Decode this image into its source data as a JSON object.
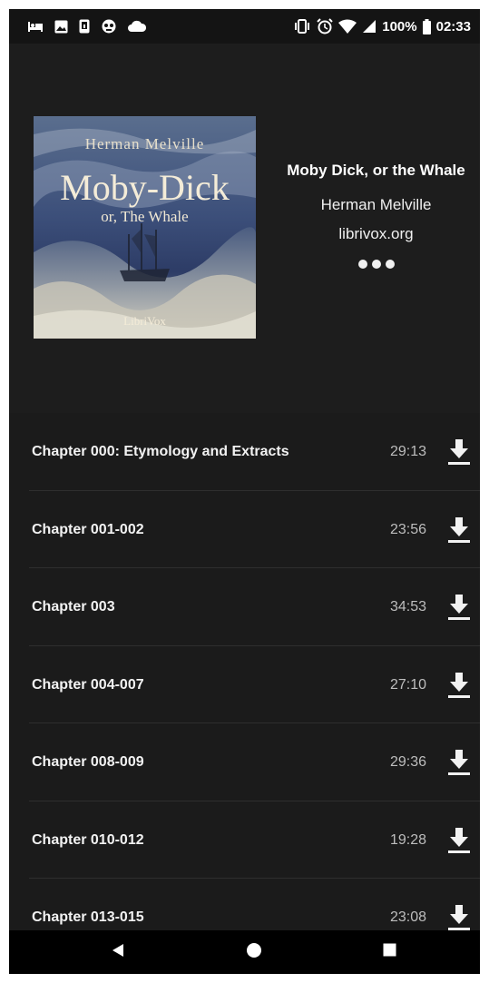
{
  "status_bar": {
    "battery_percent": "100%",
    "time": "02:33",
    "icons_left": [
      "bed-icon",
      "image-icon",
      "phone-icon",
      "gamepad-icon",
      "cloud-icon"
    ],
    "icons_right": [
      "vibrate-icon",
      "alarm-icon",
      "wifi-icon",
      "signal-icon",
      "battery-icon"
    ]
  },
  "book": {
    "cover_author": "Herman Melville",
    "cover_title": "Moby-Dick",
    "cover_subtitle": "or, The Whale",
    "cover_publisher": "LibriVox",
    "title": "Moby Dick, or the Whale",
    "author": "Herman Melville",
    "source": "librivox.org",
    "more_icon": "more-horizontal-icon"
  },
  "chapters": [
    {
      "title": "Chapter 000: Etymology and Extracts",
      "duration": "29:13"
    },
    {
      "title": "Chapter 001-002",
      "duration": "23:56"
    },
    {
      "title": "Chapter 003",
      "duration": "34:53"
    },
    {
      "title": "Chapter 004-007",
      "duration": "27:10"
    },
    {
      "title": "Chapter 008-009",
      "duration": "29:36"
    },
    {
      "title": "Chapter 010-012",
      "duration": "19:28"
    },
    {
      "title": "Chapter 013-015",
      "duration": "23:08"
    }
  ],
  "nav_bar": {
    "back_icon": "back-triangle-icon",
    "home_icon": "home-circle-icon",
    "recents_icon": "recents-square-icon"
  },
  "colors": {
    "background": "#1b1b1b",
    "header_background": "#1d1d1d",
    "text_primary": "#f2f2f2",
    "text_secondary": "#bdbdbd"
  }
}
